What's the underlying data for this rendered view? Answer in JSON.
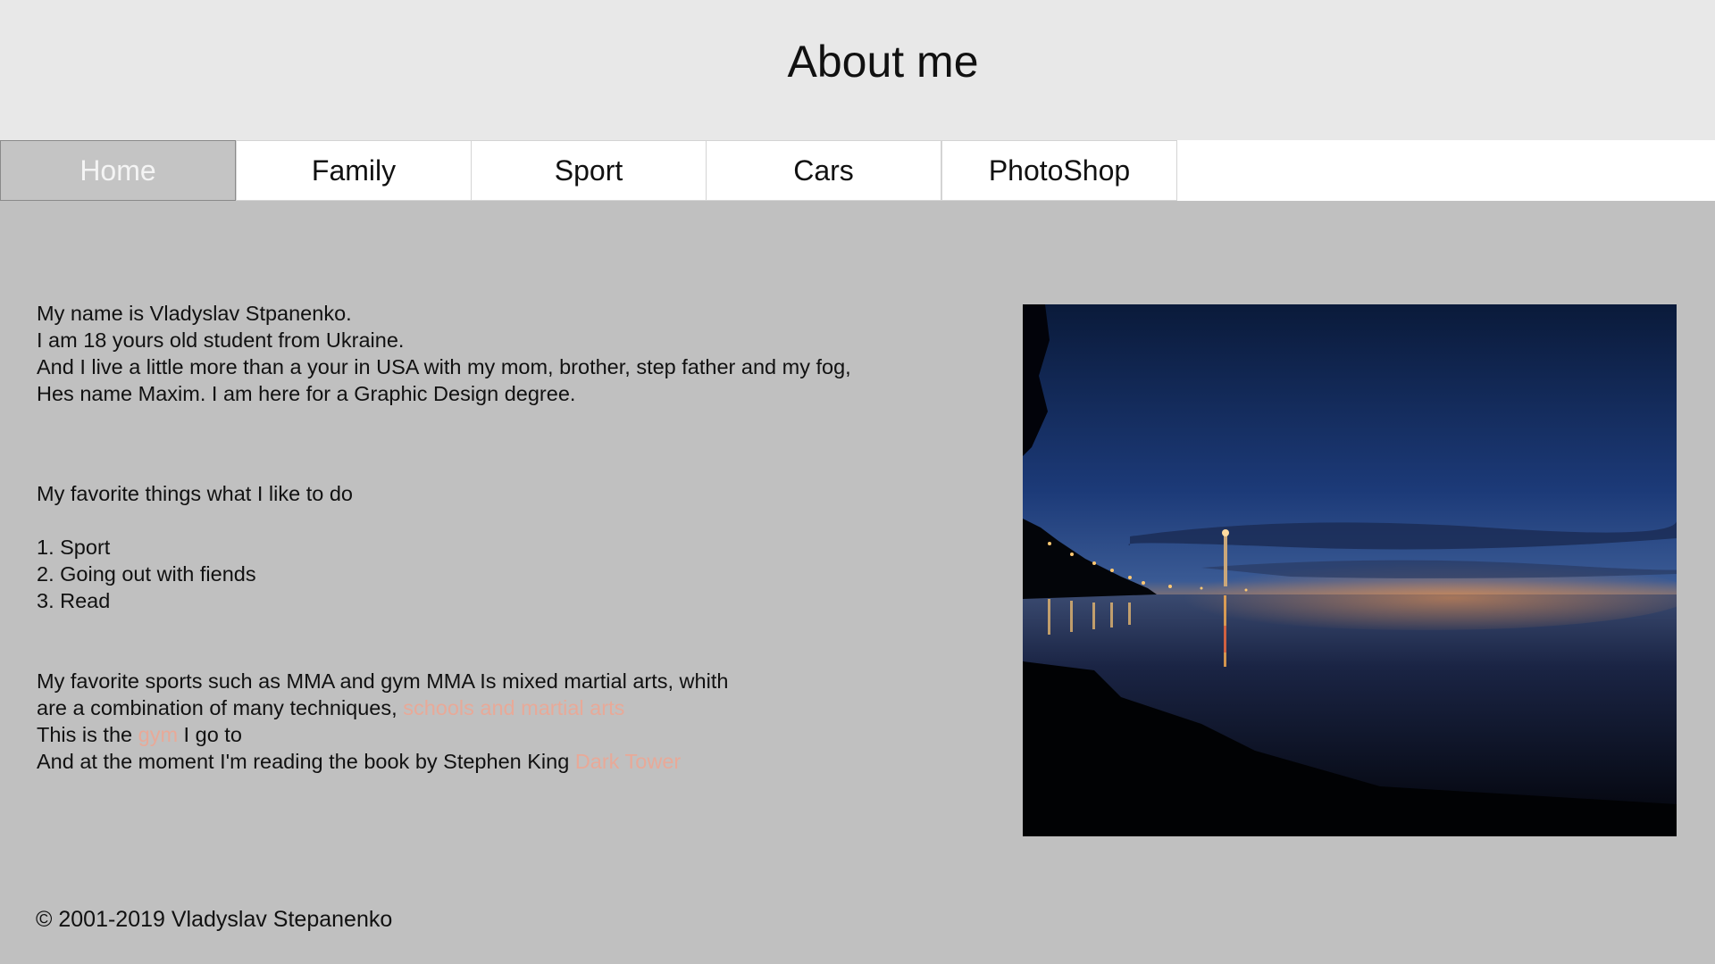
{
  "header": {
    "title": "About me"
  },
  "nav": {
    "tabs": [
      {
        "label": "Home",
        "active": true
      },
      {
        "label": "Family",
        "active": false
      },
      {
        "label": "Sport",
        "active": false
      },
      {
        "label": "Cars",
        "active": false
      },
      {
        "label": "PhotoShop",
        "active": false
      }
    ]
  },
  "intro": {
    "line1": "My name is Vladyslav Stpanenko.",
    "line2": "I am 18 yours old student from Ukraine.",
    "line3": "And I live a little more than a your in USA with my mom, brother, step father and my fog,",
    "line4": "Hes name Maxim. I am here for a Graphic Design degree."
  },
  "favorites": {
    "heading": "My favorite things what I like to do",
    "items": [
      "1. Sport",
      "2. Going out with fiends",
      "3. Read"
    ]
  },
  "sports": {
    "line1": "My favorite sports such as MMA and gym MMA Is mixed martial arts, whith",
    "line2_prefix": "are a combination of many techniques, ",
    "line2_link": "schools and martial arts",
    "line3_prefix": "This is the ",
    "line3_link": "gym",
    "line3_suffix": " I go to",
    "line4_prefix": "And at the moment I'm reading the book by Stephen King ",
    "line4_link": "Dark Tower"
  },
  "footer": {
    "copyright": "© 2001-2019 Vladyslav Stepanenko"
  },
  "colors": {
    "header_bg": "#e8e8e8",
    "page_bg": "#c0c0c0",
    "active_tab_bg": "#c4c4c4",
    "link": "#e8a998"
  }
}
